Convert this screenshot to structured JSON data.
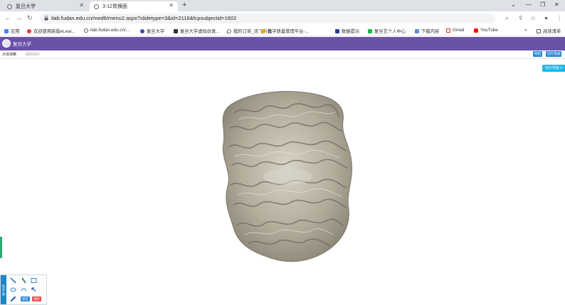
{
  "browser": {
    "tabs": [
      {
        "title": "复旦大学",
        "active": false
      },
      {
        "title": "3-12胃横面",
        "active": true
      }
    ],
    "url": "ilab.fudan.edu.cn/med6/menu2.aspx?slidetype=3&id=2116&fcpsubjectid=1602",
    "bookmarks": [
      "应用",
      "欢迎使用新版eLear...",
      "ilab.fudan.edu.cn/...",
      "复旦大学",
      "复旦大学虚拟仿真...",
      "我的订单_讯飞听见",
      "教学质量管理平台-...",
      "数据提示",
      "复旦艺个人中心",
      "下载内容",
      "Gmail",
      "YouTube"
    ],
    "reading_list": "阅读清单"
  },
  "site": {
    "logo_text": "复旦大学",
    "subtabs": {
      "active": "大体观察",
      "inactive": "组织切片"
    },
    "right_buttons": [
      "导航",
      "切片目录"
    ],
    "view_button": "切片导航 ▾"
  },
  "tool_palette": {
    "label": "标注工具",
    "save_label": "保存",
    "clear_label": "清除"
  },
  "colors": {
    "header_purple": "#6a52a8",
    "accent_blue": "#2b8bd6",
    "cyan": "#1fb6e6",
    "red": "#e84c4c"
  }
}
